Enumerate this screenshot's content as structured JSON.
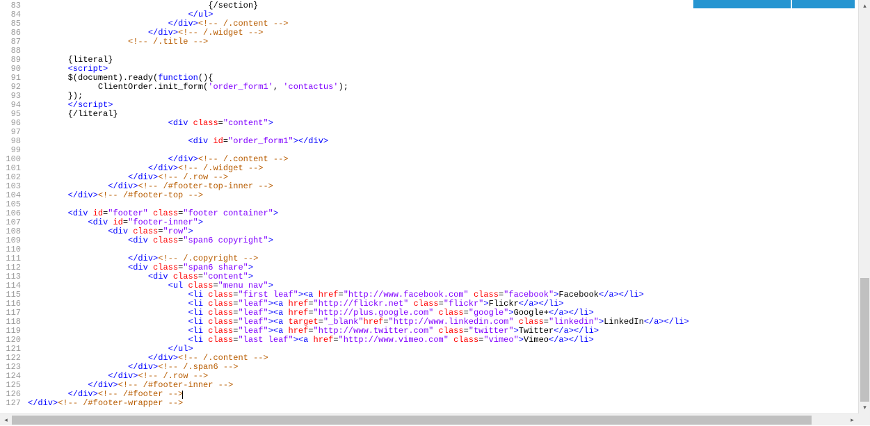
{
  "firstLine": 83,
  "lastLine": 127,
  "lines": [
    {
      "n": 83,
      "ind": 36,
      "seg": [
        {
          "t": "txt",
          "v": "{/section}"
        }
      ]
    },
    {
      "n": 84,
      "ind": 32,
      "seg": [
        {
          "t": "tag",
          "v": "</ul>"
        }
      ]
    },
    {
      "n": 85,
      "ind": 28,
      "seg": [
        {
          "t": "tag",
          "v": "</div>"
        },
        {
          "t": "comment",
          "v": "<!-- /.content -->"
        }
      ]
    },
    {
      "n": 86,
      "ind": 24,
      "seg": [
        {
          "t": "tag",
          "v": "</div>"
        },
        {
          "t": "comment",
          "v": "<!-- /.widget -->"
        }
      ]
    },
    {
      "n": 87,
      "ind": 20,
      "seg": [
        {
          "t": "comment",
          "v": "<!-- /.title -->"
        }
      ]
    },
    {
      "n": 88,
      "ind": 0,
      "seg": []
    },
    {
      "n": 89,
      "ind": 8,
      "seg": [
        {
          "t": "txt",
          "v": "{literal}"
        }
      ]
    },
    {
      "n": 90,
      "ind": 8,
      "seg": [
        {
          "t": "tag",
          "v": "<script>"
        }
      ]
    },
    {
      "n": 91,
      "ind": 8,
      "seg": [
        {
          "t": "js-id",
          "v": "$(document).ready("
        },
        {
          "t": "js-kw",
          "v": "function"
        },
        {
          "t": "js-id",
          "v": "(){"
        }
      ]
    },
    {
      "n": 92,
      "ind": 14,
      "seg": [
        {
          "t": "js-id",
          "v": "ClientOrder.init_form("
        },
        {
          "t": "js-str",
          "v": "'order_form1'"
        },
        {
          "t": "js-id",
          "v": ", "
        },
        {
          "t": "js-str",
          "v": "'contactus'"
        },
        {
          "t": "js-id",
          "v": ");"
        }
      ]
    },
    {
      "n": 93,
      "ind": 8,
      "seg": [
        {
          "t": "js-id",
          "v": "});"
        }
      ]
    },
    {
      "n": 94,
      "ind": 8,
      "seg": [
        {
          "t": "tag",
          "v": "</script>"
        }
      ]
    },
    {
      "n": 95,
      "ind": 8,
      "seg": [
        {
          "t": "txt",
          "v": "{/literal}"
        }
      ]
    },
    {
      "n": 96,
      "ind": 28,
      "seg": [
        {
          "t": "tag",
          "v": "<div "
        },
        {
          "t": "attr-name",
          "v": "class"
        },
        {
          "t": "attr-eq",
          "v": "="
        },
        {
          "t": "attr-val",
          "v": "\"content\""
        },
        {
          "t": "tag",
          "v": ">"
        }
      ]
    },
    {
      "n": 97,
      "ind": 0,
      "seg": []
    },
    {
      "n": 98,
      "ind": 32,
      "seg": [
        {
          "t": "tag",
          "v": "<div "
        },
        {
          "t": "attr-name",
          "v": "id"
        },
        {
          "t": "attr-eq",
          "v": "="
        },
        {
          "t": "attr-val",
          "v": "\"order_form1\""
        },
        {
          "t": "tag",
          "v": "></div>"
        }
      ]
    },
    {
      "n": 99,
      "ind": 0,
      "seg": []
    },
    {
      "n": 100,
      "ind": 28,
      "seg": [
        {
          "t": "tag",
          "v": "</div>"
        },
        {
          "t": "comment",
          "v": "<!-- /.content -->"
        }
      ]
    },
    {
      "n": 101,
      "ind": 24,
      "seg": [
        {
          "t": "tag",
          "v": "</div>"
        },
        {
          "t": "comment",
          "v": "<!-- /.widget -->"
        }
      ]
    },
    {
      "n": 102,
      "ind": 20,
      "seg": [
        {
          "t": "tag",
          "v": "</div>"
        },
        {
          "t": "comment",
          "v": "<!-- /.row -->"
        }
      ]
    },
    {
      "n": 103,
      "ind": 16,
      "seg": [
        {
          "t": "tag",
          "v": "</div>"
        },
        {
          "t": "comment",
          "v": "<!-- /#footer-top-inner -->"
        }
      ]
    },
    {
      "n": 104,
      "ind": 8,
      "seg": [
        {
          "t": "tag",
          "v": "</div>"
        },
        {
          "t": "comment",
          "v": "<!-- /#footer-top -->"
        }
      ]
    },
    {
      "n": 105,
      "ind": 0,
      "seg": []
    },
    {
      "n": 106,
      "ind": 8,
      "seg": [
        {
          "t": "tag",
          "v": "<div "
        },
        {
          "t": "attr-name",
          "v": "id"
        },
        {
          "t": "attr-eq",
          "v": "="
        },
        {
          "t": "attr-val",
          "v": "\"footer\""
        },
        {
          "t": "tag",
          "v": " "
        },
        {
          "t": "attr-name",
          "v": "class"
        },
        {
          "t": "attr-eq",
          "v": "="
        },
        {
          "t": "attr-val",
          "v": "\"footer container\""
        },
        {
          "t": "tag",
          "v": ">"
        }
      ]
    },
    {
      "n": 107,
      "ind": 12,
      "seg": [
        {
          "t": "tag",
          "v": "<div "
        },
        {
          "t": "attr-name",
          "v": "id"
        },
        {
          "t": "attr-eq",
          "v": "="
        },
        {
          "t": "attr-val",
          "v": "\"footer-inner\""
        },
        {
          "t": "tag",
          "v": ">"
        }
      ]
    },
    {
      "n": 108,
      "ind": 16,
      "seg": [
        {
          "t": "tag",
          "v": "<div "
        },
        {
          "t": "attr-name",
          "v": "class"
        },
        {
          "t": "attr-eq",
          "v": "="
        },
        {
          "t": "attr-val",
          "v": "\"row\""
        },
        {
          "t": "tag",
          "v": ">"
        }
      ]
    },
    {
      "n": 109,
      "ind": 20,
      "seg": [
        {
          "t": "tag",
          "v": "<div "
        },
        {
          "t": "attr-name",
          "v": "class"
        },
        {
          "t": "attr-eq",
          "v": "="
        },
        {
          "t": "attr-val",
          "v": "\"span6 copyright\""
        },
        {
          "t": "tag",
          "v": ">"
        }
      ]
    },
    {
      "n": 110,
      "ind": 0,
      "seg": []
    },
    {
      "n": 111,
      "ind": 20,
      "seg": [
        {
          "t": "tag",
          "v": "</div>"
        },
        {
          "t": "comment",
          "v": "<!-- /.copyright -->"
        }
      ]
    },
    {
      "n": 112,
      "ind": 20,
      "seg": [
        {
          "t": "tag",
          "v": "<div "
        },
        {
          "t": "attr-name",
          "v": "class"
        },
        {
          "t": "attr-eq",
          "v": "="
        },
        {
          "t": "attr-val",
          "v": "\"span6 share\""
        },
        {
          "t": "tag",
          "v": ">"
        }
      ]
    },
    {
      "n": 113,
      "ind": 24,
      "seg": [
        {
          "t": "tag",
          "v": "<div "
        },
        {
          "t": "attr-name",
          "v": "class"
        },
        {
          "t": "attr-eq",
          "v": "="
        },
        {
          "t": "attr-val",
          "v": "\"content\""
        },
        {
          "t": "tag",
          "v": ">"
        }
      ]
    },
    {
      "n": 114,
      "ind": 28,
      "seg": [
        {
          "t": "tag",
          "v": "<ul "
        },
        {
          "t": "attr-name",
          "v": "class"
        },
        {
          "t": "attr-eq",
          "v": "="
        },
        {
          "t": "attr-val",
          "v": "\"menu nav\""
        },
        {
          "t": "tag",
          "v": ">"
        }
      ]
    },
    {
      "n": 115,
      "ind": 32,
      "seg": [
        {
          "t": "tag",
          "v": "<li "
        },
        {
          "t": "attr-name",
          "v": "class"
        },
        {
          "t": "attr-eq",
          "v": "="
        },
        {
          "t": "attr-val",
          "v": "\"first leaf\""
        },
        {
          "t": "tag",
          "v": "><a "
        },
        {
          "t": "attr-name",
          "v": "href"
        },
        {
          "t": "attr-eq",
          "v": "="
        },
        {
          "t": "attr-val",
          "v": "\"http://www.facebook.com\""
        },
        {
          "t": "tag",
          "v": " "
        },
        {
          "t": "attr-name",
          "v": "class"
        },
        {
          "t": "attr-eq",
          "v": "="
        },
        {
          "t": "attr-val",
          "v": "\"facebook\""
        },
        {
          "t": "tag",
          "v": ">"
        },
        {
          "t": "txt",
          "v": "Facebook"
        },
        {
          "t": "tag",
          "v": "</a></li>"
        }
      ]
    },
    {
      "n": 116,
      "ind": 32,
      "seg": [
        {
          "t": "tag",
          "v": "<li "
        },
        {
          "t": "attr-name",
          "v": "class"
        },
        {
          "t": "attr-eq",
          "v": "="
        },
        {
          "t": "attr-val",
          "v": "\"leaf\""
        },
        {
          "t": "tag",
          "v": "><a "
        },
        {
          "t": "attr-name",
          "v": "href"
        },
        {
          "t": "attr-eq",
          "v": "="
        },
        {
          "t": "attr-val",
          "v": "\"http://flickr.net\""
        },
        {
          "t": "tag",
          "v": " "
        },
        {
          "t": "attr-name",
          "v": "class"
        },
        {
          "t": "attr-eq",
          "v": "="
        },
        {
          "t": "attr-val",
          "v": "\"flickr\""
        },
        {
          "t": "tag",
          "v": ">"
        },
        {
          "t": "txt",
          "v": "Flickr"
        },
        {
          "t": "tag",
          "v": "</a></li>"
        }
      ]
    },
    {
      "n": 117,
      "ind": 32,
      "seg": [
        {
          "t": "tag",
          "v": "<li "
        },
        {
          "t": "attr-name",
          "v": "class"
        },
        {
          "t": "attr-eq",
          "v": "="
        },
        {
          "t": "attr-val",
          "v": "\"leaf\""
        },
        {
          "t": "tag",
          "v": "><a "
        },
        {
          "t": "attr-name",
          "v": "href"
        },
        {
          "t": "attr-eq",
          "v": "="
        },
        {
          "t": "attr-val",
          "v": "\"http://plus.google.com\""
        },
        {
          "t": "tag",
          "v": " "
        },
        {
          "t": "attr-name",
          "v": "class"
        },
        {
          "t": "attr-eq",
          "v": "="
        },
        {
          "t": "attr-val",
          "v": "\"google\""
        },
        {
          "t": "tag",
          "v": ">"
        },
        {
          "t": "txt",
          "v": "Google+"
        },
        {
          "t": "tag",
          "v": "</a></li>"
        }
      ]
    },
    {
      "n": 118,
      "ind": 32,
      "seg": [
        {
          "t": "tag",
          "v": "<li "
        },
        {
          "t": "attr-name",
          "v": "class"
        },
        {
          "t": "attr-eq",
          "v": "="
        },
        {
          "t": "attr-val",
          "v": "\"leaf\""
        },
        {
          "t": "tag",
          "v": "><a "
        },
        {
          "t": "attr-name",
          "v": "target"
        },
        {
          "t": "attr-eq",
          "v": "="
        },
        {
          "t": "attr-val",
          "v": "\"_blank\""
        },
        {
          "t": "attr-name",
          "v": "href"
        },
        {
          "t": "attr-eq",
          "v": "="
        },
        {
          "t": "attr-val",
          "v": "\"http://www.linkedin.com\""
        },
        {
          "t": "tag",
          "v": " "
        },
        {
          "t": "attr-name",
          "v": "class"
        },
        {
          "t": "attr-eq",
          "v": "="
        },
        {
          "t": "attr-val",
          "v": "\"linkedin\""
        },
        {
          "t": "tag",
          "v": ">"
        },
        {
          "t": "txt",
          "v": "LinkedIn"
        },
        {
          "t": "tag",
          "v": "</a></li>"
        }
      ]
    },
    {
      "n": 119,
      "ind": 32,
      "seg": [
        {
          "t": "tag",
          "v": "<li "
        },
        {
          "t": "attr-name",
          "v": "class"
        },
        {
          "t": "attr-eq",
          "v": "="
        },
        {
          "t": "attr-val",
          "v": "\"leaf\""
        },
        {
          "t": "tag",
          "v": "><a "
        },
        {
          "t": "attr-name",
          "v": "href"
        },
        {
          "t": "attr-eq",
          "v": "="
        },
        {
          "t": "attr-val",
          "v": "\"http://www.twitter.com\""
        },
        {
          "t": "tag",
          "v": " "
        },
        {
          "t": "attr-name",
          "v": "class"
        },
        {
          "t": "attr-eq",
          "v": "="
        },
        {
          "t": "attr-val",
          "v": "\"twitter\""
        },
        {
          "t": "tag",
          "v": ">"
        },
        {
          "t": "txt",
          "v": "Twitter"
        },
        {
          "t": "tag",
          "v": "</a></li>"
        }
      ]
    },
    {
      "n": 120,
      "ind": 32,
      "seg": [
        {
          "t": "tag",
          "v": "<li "
        },
        {
          "t": "attr-name",
          "v": "class"
        },
        {
          "t": "attr-eq",
          "v": "="
        },
        {
          "t": "attr-val",
          "v": "\"last leaf\""
        },
        {
          "t": "tag",
          "v": "><a "
        },
        {
          "t": "attr-name",
          "v": "href"
        },
        {
          "t": "attr-eq",
          "v": "="
        },
        {
          "t": "attr-val",
          "v": "\"http://www.vimeo.com\""
        },
        {
          "t": "tag",
          "v": " "
        },
        {
          "t": "attr-name",
          "v": "class"
        },
        {
          "t": "attr-eq",
          "v": "="
        },
        {
          "t": "attr-val",
          "v": "\"vimeo\""
        },
        {
          "t": "tag",
          "v": ">"
        },
        {
          "t": "txt",
          "v": "Vimeo"
        },
        {
          "t": "tag",
          "v": "</a></li>"
        }
      ]
    },
    {
      "n": 121,
      "ind": 28,
      "seg": [
        {
          "t": "tag",
          "v": "</ul>"
        }
      ]
    },
    {
      "n": 122,
      "ind": 24,
      "seg": [
        {
          "t": "tag",
          "v": "</div>"
        },
        {
          "t": "comment",
          "v": "<!-- /.content -->"
        }
      ]
    },
    {
      "n": 123,
      "ind": 20,
      "seg": [
        {
          "t": "tag",
          "v": "</div>"
        },
        {
          "t": "comment",
          "v": "<!-- /.span6 -->"
        }
      ]
    },
    {
      "n": 124,
      "ind": 16,
      "seg": [
        {
          "t": "tag",
          "v": "</div>"
        },
        {
          "t": "comment",
          "v": "<!-- /.row -->"
        }
      ]
    },
    {
      "n": 125,
      "ind": 12,
      "seg": [
        {
          "t": "tag",
          "v": "</div>"
        },
        {
          "t": "comment",
          "v": "<!-- /#footer-inner -->"
        }
      ]
    },
    {
      "n": 126,
      "ind": 8,
      "seg": [
        {
          "t": "tag",
          "v": "</div>"
        },
        {
          "t": "comment",
          "v": "<!-- /#footer -->"
        }
      ],
      "cursor": true
    },
    {
      "n": 127,
      "ind": 0,
      "seg": [
        {
          "t": "tag",
          "v": "</div>"
        },
        {
          "t": "comment",
          "v": "<!-- /#footer-wrapper -->"
        }
      ]
    }
  ],
  "scroll": {
    "up": "▴",
    "down": "▾",
    "left": "◂",
    "right": "▸"
  }
}
